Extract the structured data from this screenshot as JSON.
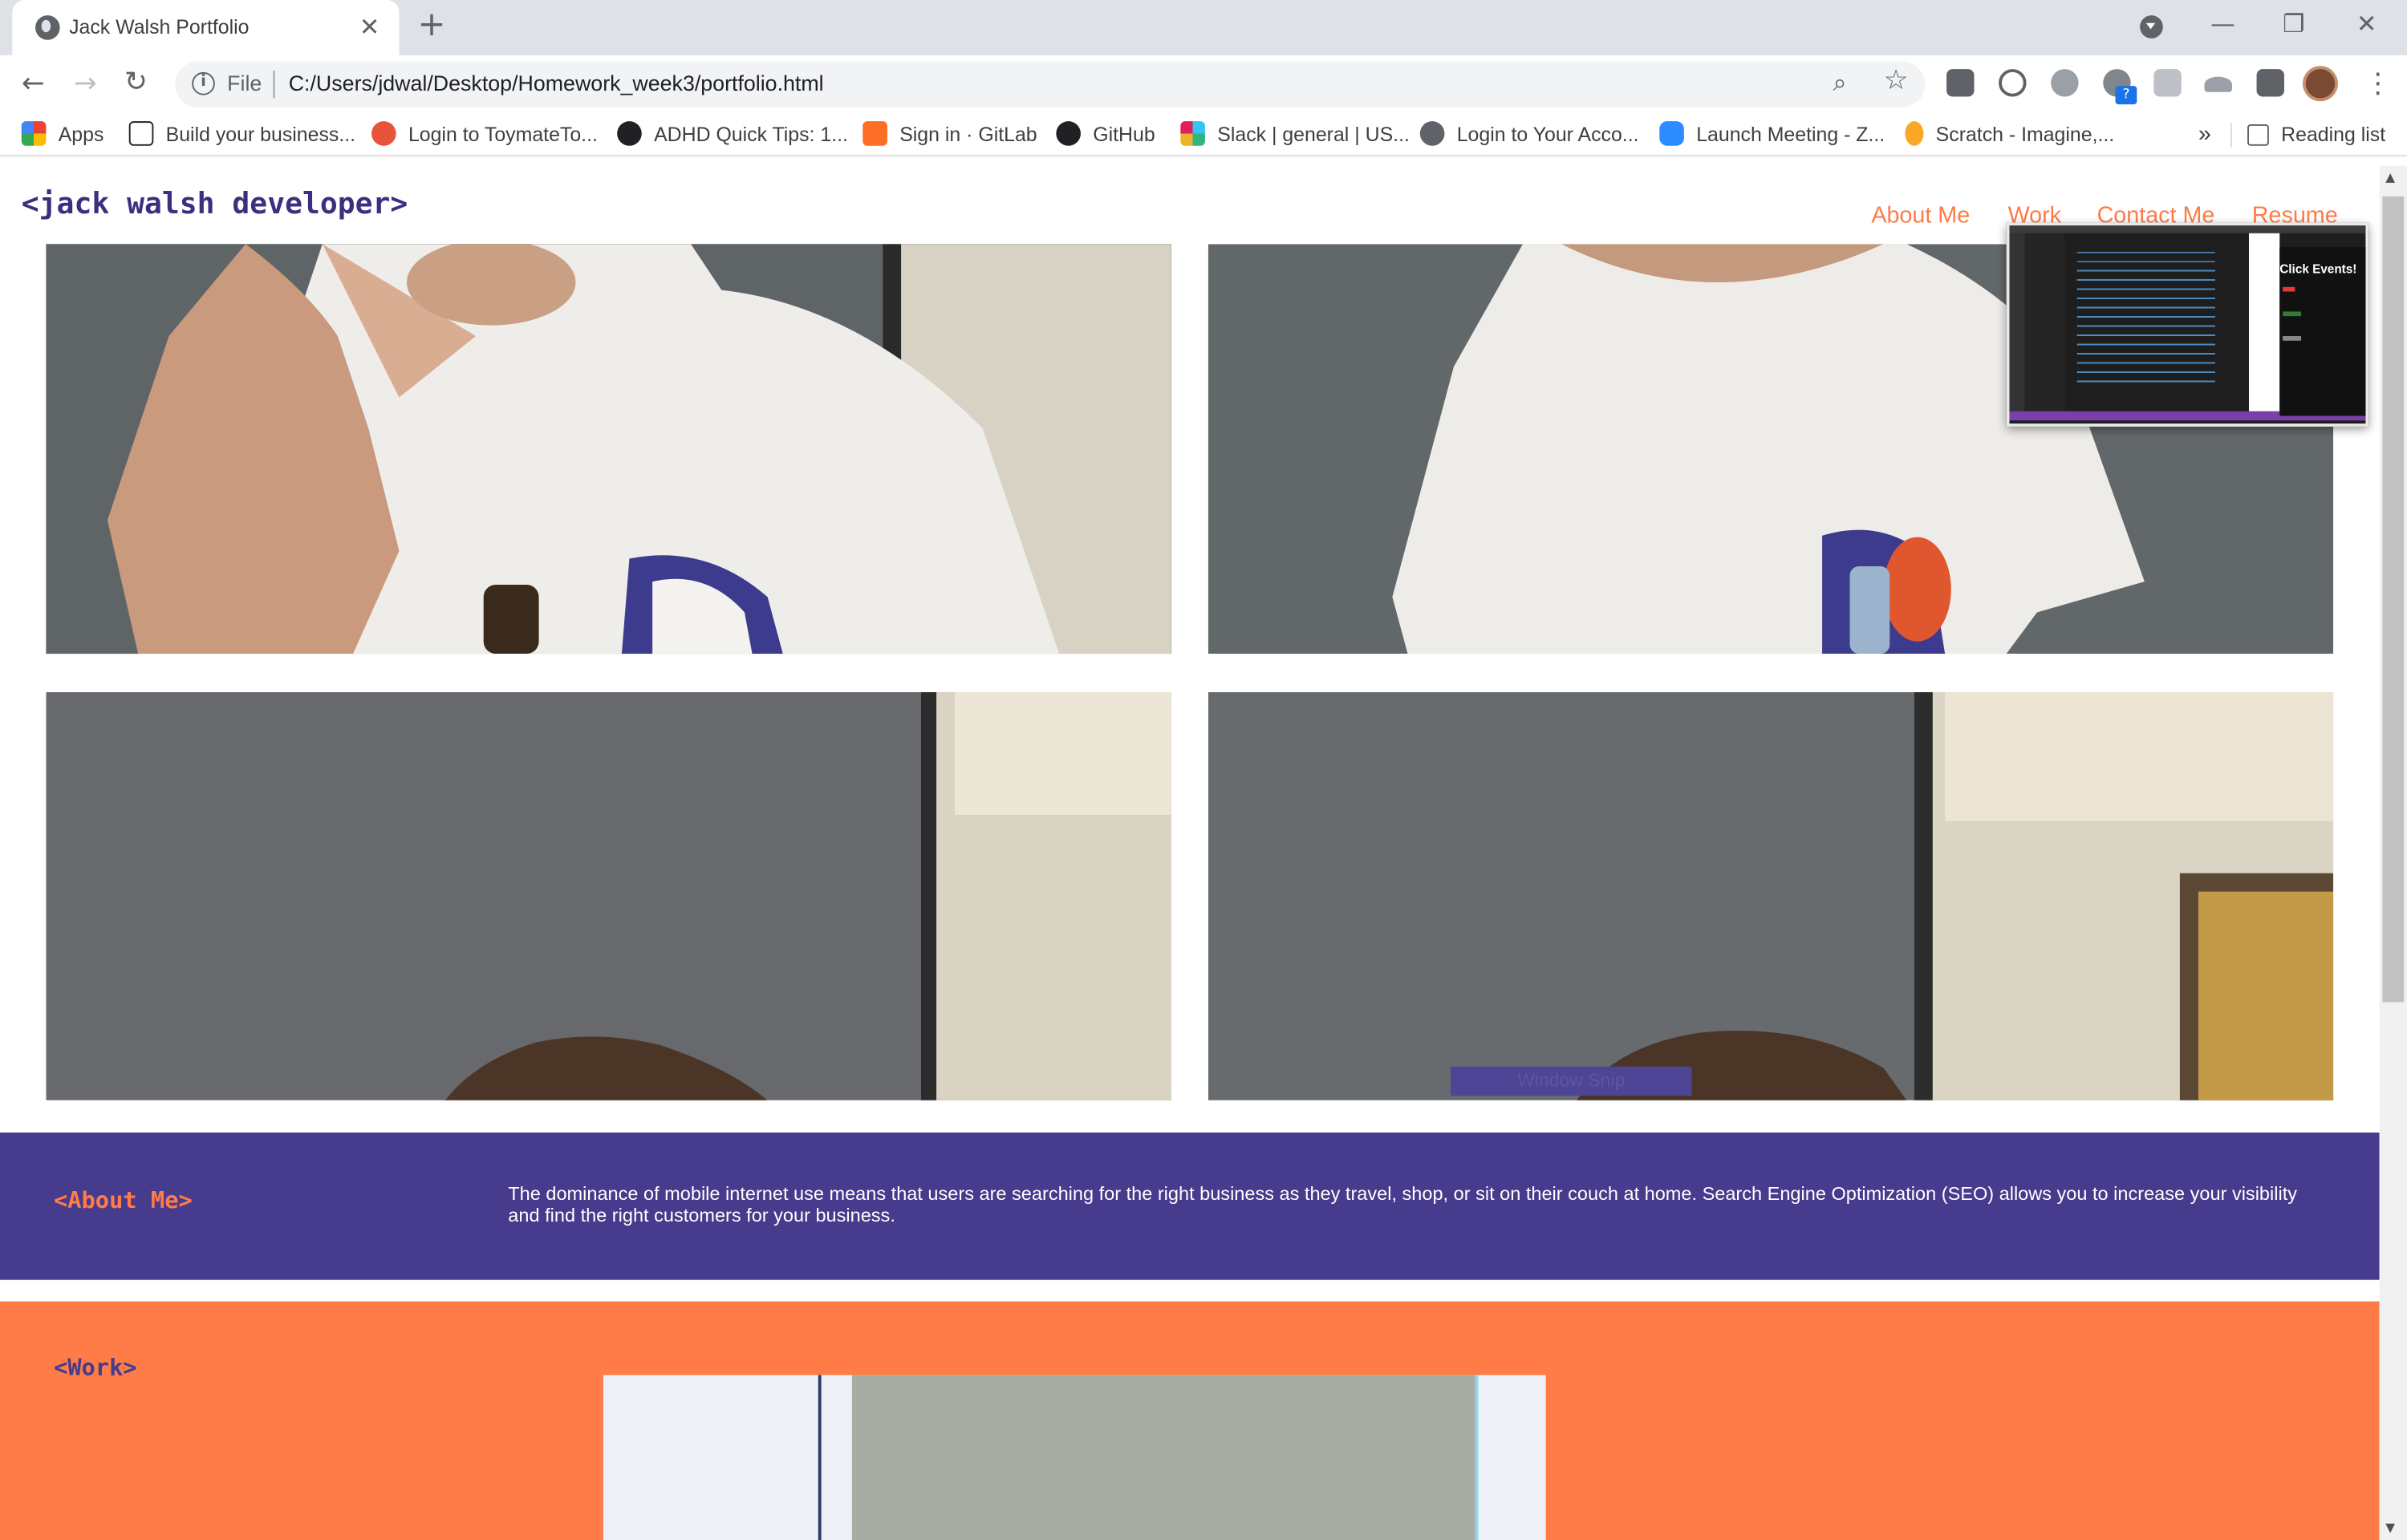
{
  "browser": {
    "tab_title": "Jack Walsh Portfolio",
    "tab_close": "✕",
    "new_tab": "+",
    "window_controls": [
      "—",
      "❐",
      "✕"
    ],
    "address": {
      "scheme_label": "File",
      "url": "C:/Users/jdwal/Desktop/Homework_week3/portfolio.html"
    },
    "nav_icons": [
      "back-icon",
      "forward-icon",
      "reload-icon"
    ],
    "extension_icons": [
      "help-icon",
      "cloud-icon",
      "check-icon",
      "chat-icon",
      "r-icon",
      "hat-icon",
      "puzzle-icon"
    ],
    "extension_badge": "?",
    "bookmarks": [
      {
        "label": "Apps",
        "color": "#4285f4"
      },
      {
        "label": "Build your business...",
        "color": "#222222"
      },
      {
        "label": "Login to ToymateTo...",
        "color": "#e8533c"
      },
      {
        "label": "ADHD Quick Tips: 1...",
        "color": "#202124"
      },
      {
        "label": "Sign in · GitLab",
        "color": "#fc6d26"
      },
      {
        "label": "GitHub",
        "color": "#202124"
      },
      {
        "label": "Slack | general | US...",
        "color": "#36c5f0"
      },
      {
        "label": "Login to Your Acco...",
        "color": "#5f6368"
      },
      {
        "label": "Launch Meeting - Z...",
        "color": "#2d8cff"
      },
      {
        "label": "Scratch - Imagine,...",
        "color": "#f9a825"
      }
    ],
    "bookmarks_more": "»",
    "reading_list": "Reading list"
  },
  "site": {
    "logo": "<jack walsh developer>",
    "nav": [
      "About Me",
      "Work",
      "Contact Me",
      "Resume"
    ],
    "about": {
      "heading": "<About Me>",
      "text": "The dominance of mobile internet use means that users are searching for the right business as they travel, shop, or sit on their couch at home. Search Engine Optimization (SEO) allows you to increase your visibility and find the right customers for your business."
    },
    "work": {
      "heading": "<Work>"
    },
    "snip_overlay": "Window Snip"
  },
  "preview_popup": {
    "title": "Click Events!"
  },
  "colors": {
    "purple": "#463b8c",
    "orange": "#ff7b47",
    "link": "#ff7b47"
  }
}
